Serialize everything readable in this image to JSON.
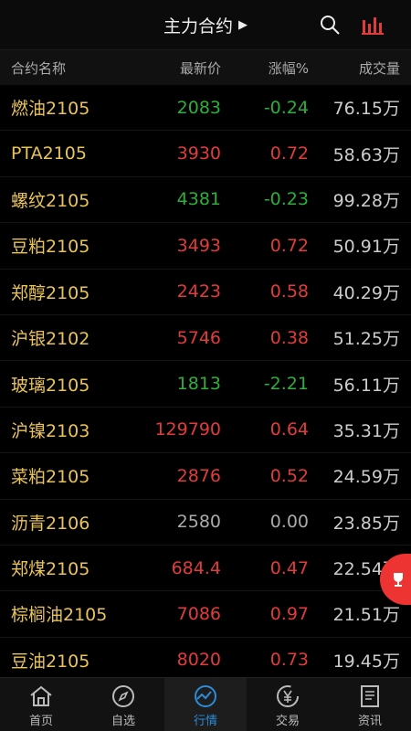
{
  "header": {
    "title": "主力合约",
    "caret": "▶"
  },
  "columns": {
    "name": "合约名称",
    "price": "最新价",
    "change": "涨幅%",
    "volume": "成交量"
  },
  "rows": [
    {
      "name": "燃油2105",
      "price": "2083",
      "change": "-0.24",
      "volume": "76.15万",
      "trend": "down"
    },
    {
      "name": "PTA2105",
      "price": "3930",
      "change": "0.72",
      "volume": "58.63万",
      "trend": "up"
    },
    {
      "name": "螺纹2105",
      "price": "4381",
      "change": "-0.23",
      "volume": "99.28万",
      "trend": "down"
    },
    {
      "name": "豆粕2105",
      "price": "3493",
      "change": "0.72",
      "volume": "50.91万",
      "trend": "up"
    },
    {
      "name": "郑醇2105",
      "price": "2423",
      "change": "0.58",
      "volume": "40.29万",
      "trend": "up"
    },
    {
      "name": "沪银2102",
      "price": "5746",
      "change": "0.38",
      "volume": "51.25万",
      "trend": "up"
    },
    {
      "name": "玻璃2105",
      "price": "1813",
      "change": "-2.21",
      "volume": "56.11万",
      "trend": "down"
    },
    {
      "name": "沪镍2103",
      "price": "129790",
      "change": "0.64",
      "volume": "35.31万",
      "trend": "up"
    },
    {
      "name": "菜粕2105",
      "price": "2876",
      "change": "0.52",
      "volume": "24.59万",
      "trend": "up"
    },
    {
      "name": "沥青2106",
      "price": "2580",
      "change": "0.00",
      "volume": "23.85万",
      "trend": "flat"
    },
    {
      "name": "郑煤2105",
      "price": "684.4",
      "change": "0.47",
      "volume": "22.54万",
      "trend": "up"
    },
    {
      "name": "棕榈油2105",
      "price": "7086",
      "change": "0.97",
      "volume": "21.51万",
      "trend": "up"
    },
    {
      "name": "豆油2105",
      "price": "8020",
      "change": "0.73",
      "volume": "19.45万",
      "trend": "up"
    }
  ],
  "tabs": [
    {
      "label": "首页",
      "icon": "home-icon"
    },
    {
      "label": "自选",
      "icon": "compass-icon"
    },
    {
      "label": "行情",
      "icon": "trend-icon",
      "active": true
    },
    {
      "label": "交易",
      "icon": "yen-icon"
    },
    {
      "label": "资讯",
      "icon": "news-icon"
    }
  ],
  "colors": {
    "up": "#e23b3b",
    "down": "#2fae3b",
    "name": "#e9c35a",
    "accent": "#2d8bd8"
  }
}
